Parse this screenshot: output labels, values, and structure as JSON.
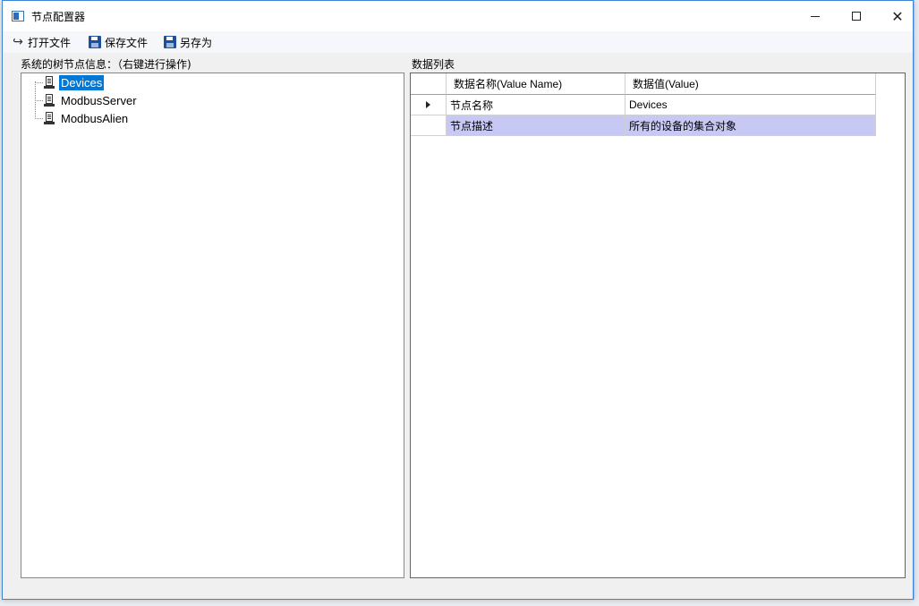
{
  "window": {
    "title": "节点配置器"
  },
  "toolbar": {
    "open_label": "打开文件",
    "save_label": "保存文件",
    "save_as_label": "另存为"
  },
  "tree": {
    "label": "系统的树节点信息：（右键进行操作)",
    "nodes": [
      {
        "label": "Devices",
        "selected": true
      },
      {
        "label": "ModbusServer",
        "selected": false
      },
      {
        "label": "ModbusAlien",
        "selected": false
      }
    ]
  },
  "grid": {
    "label": "数据列表",
    "columns": [
      "数据名称(Value Name)",
      "数据值(Value)"
    ],
    "rows": [
      {
        "name": "节点名称",
        "value": "Devices",
        "current": true
      },
      {
        "name": "节点描述",
        "value": "所有的设备的集合对象",
        "selected": true
      }
    ]
  },
  "colors": {
    "selection_blue": "#0078d7",
    "grid_row_selected": "#c8c8f4",
    "window_border": "#3d84d8"
  }
}
